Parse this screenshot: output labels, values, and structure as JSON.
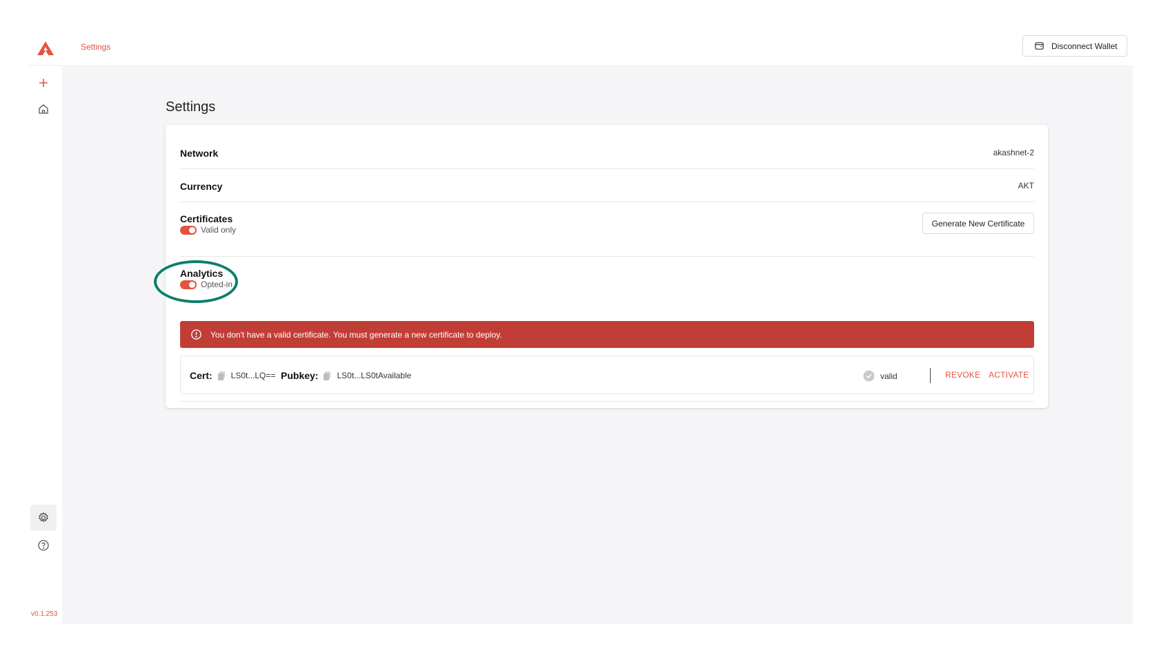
{
  "header": {
    "breadcrumb": "Settings",
    "disconnect_label": "Disconnect Wallet",
    "brand_color": "#e5533f"
  },
  "sidebar": {
    "icons": [
      "plus-icon",
      "home-icon",
      "gear-icon",
      "help-icon"
    ],
    "version": "v0.1.253"
  },
  "main": {
    "title": "Settings",
    "network": {
      "label": "Network",
      "value": "akashnet-2"
    },
    "currency": {
      "label": "Currency",
      "value": "AKT"
    },
    "certificates": {
      "label": "Certificates",
      "toggle_label": "Valid only",
      "generate_label": "Generate New Certificate"
    },
    "analytics": {
      "label": "Analytics",
      "toggle_label": "Opted-in"
    },
    "alert": {
      "message": "You don't have a valid certificate. You must generate a new certificate to deploy.",
      "color": "#c13e37"
    },
    "cert_row": {
      "cert_key": "Cert:",
      "cert_value": "LS0t...LQ==",
      "pubkey_key": "Pubkey:",
      "pubkey_value": "LS0t...LS0tAvailable",
      "status": "valid",
      "revoke_label": "REVOKE",
      "activate_label": "ACTIVATE"
    }
  },
  "annotation": {
    "color": "#0a7f6b"
  }
}
